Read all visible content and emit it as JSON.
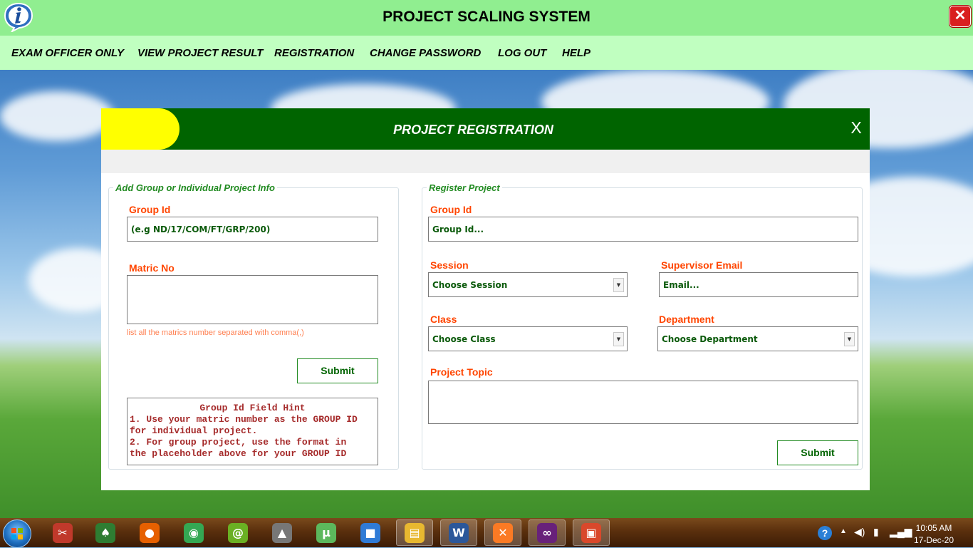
{
  "app": {
    "title": "PROJECT SCALING SYSTEM",
    "close_glyph": "✕",
    "info_icon": "info-icon"
  },
  "menu": [
    {
      "label": "EXAM OFFICER ONLY"
    },
    {
      "label": "VIEW PROJECT RESULT"
    },
    {
      "label": "REGISTRATION"
    },
    {
      "label": "CHANGE PASSWORD"
    },
    {
      "label": "LOG OUT"
    },
    {
      "label": "HELP"
    }
  ],
  "dialog": {
    "title": "PROJECT REGISTRATION",
    "close_label": "X",
    "left_panel": {
      "legend": "Add Group or Individual Project Info",
      "group_id_label": "Group Id",
      "group_id_placeholder": "(e.g ND/17/COM/FT/GRP/200)",
      "matric_label": "Matric No",
      "matric_value": "",
      "matric_hint": "list all the matrics number separated with comma(,)",
      "submit_label": "Submit",
      "hint_title": "Group Id Field Hint",
      "hint_lines": [
        "1. Use your matric number as the GROUP ID",
        "for individual project.",
        "2. For group project, use the format in",
        "the placeholder above for your GROUP ID"
      ]
    },
    "right_panel": {
      "legend": "Register Project",
      "group_id_label": "Group Id",
      "group_id_placeholder": "Group Id...",
      "session_label": "Session",
      "session_value": "Choose Session",
      "email_label": "Supervisor Email",
      "email_placeholder": "Email...",
      "class_label": "Class",
      "class_value": "Choose Class",
      "department_label": "Department",
      "department_value": "Choose Department",
      "topic_label": "Project Topic",
      "topic_value": "",
      "submit_label": "Submit"
    }
  },
  "taskbar": {
    "apps": [
      {
        "name": "snipping-tool-icon",
        "glyph": "✂",
        "color": "#c0392b"
      },
      {
        "name": "solitaire-icon",
        "glyph": "♠",
        "color": "#2e7d32"
      },
      {
        "name": "firefox-icon",
        "glyph": "●",
        "color": "#e66000"
      },
      {
        "name": "chrome-icon",
        "glyph": "◉",
        "color": "#34a853"
      },
      {
        "name": "chameleon-icon",
        "glyph": "@",
        "color": "#6ab023"
      },
      {
        "name": "inkscape-icon",
        "glyph": "▲",
        "color": "#777777"
      },
      {
        "name": "utorrent-icon",
        "glyph": "µ",
        "color": "#5cb85c"
      },
      {
        "name": "virtualbox-icon",
        "glyph": "■",
        "color": "#2f7bd6"
      },
      {
        "name": "file-explorer-icon",
        "glyph": "▤",
        "color": "#e8b830"
      },
      {
        "name": "word-icon",
        "glyph": "W",
        "color": "#2b579a"
      },
      {
        "name": "xampp-icon",
        "glyph": "✕",
        "color": "#fb7a24"
      },
      {
        "name": "visual-studio-icon",
        "glyph": "∞",
        "color": "#68217a"
      },
      {
        "name": "windows-forms-app-icon",
        "glyph": "▣",
        "color": "#d9482b"
      }
    ],
    "time": "10:05 AM",
    "date": "17-Dec-20"
  },
  "colors": {
    "title_bar": "#90ee90",
    "menu_bar": "#c0ffc0",
    "dialog_header": "#006400",
    "accent_yellow": "#ffff00",
    "label_orange": "#ff4500",
    "input_text_green": "#0b5a0b"
  }
}
